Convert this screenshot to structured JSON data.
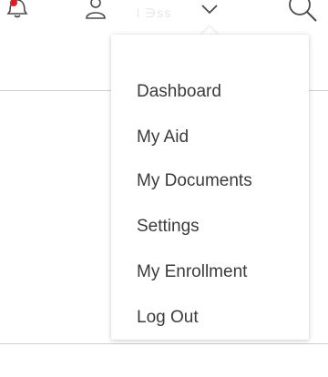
{
  "header": {
    "user_name": "l ∋ss",
    "icons": {
      "bell": "bell-icon",
      "user": "user-icon",
      "chevron": "chevron-down-icon",
      "search": "search-icon"
    }
  },
  "dropdown": {
    "items": [
      {
        "label": "Dashboard"
      },
      {
        "label": "My Aid"
      },
      {
        "label": "My Documents"
      },
      {
        "label": "Settings"
      },
      {
        "label": "My Enrollment"
      },
      {
        "label": "Log Out"
      }
    ]
  },
  "colors": {
    "accent": "#d91f26",
    "icon_stroke": "#4a4a4a",
    "menu_text": "#3b3b3b",
    "divider": "#cfcfcf"
  }
}
